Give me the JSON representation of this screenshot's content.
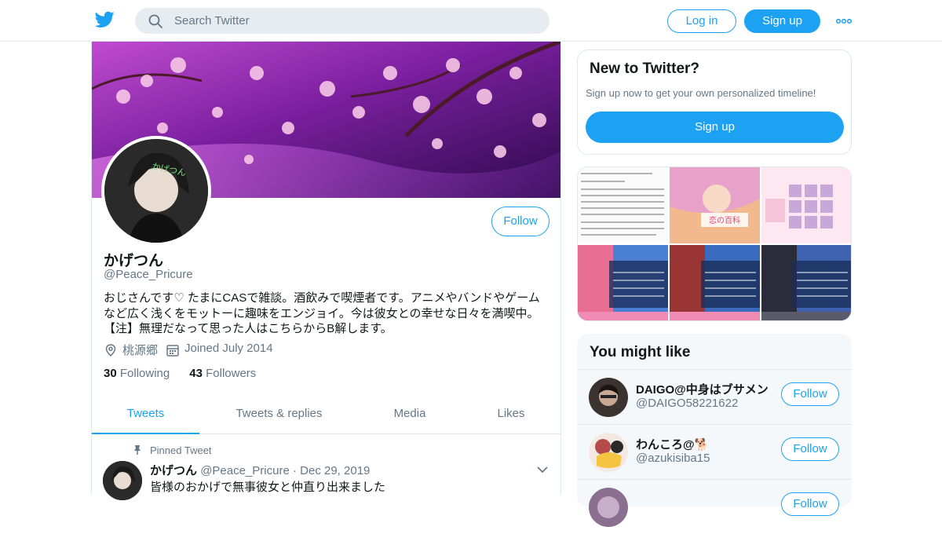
{
  "header": {
    "search_placeholder": "Search Twitter",
    "login_label": "Log in",
    "signup_label": "Sign up",
    "brand_color": "#1da1f2"
  },
  "profile": {
    "avatar_overlay": "かげつん",
    "name": "かげつん",
    "handle": "@Peace_Pricure",
    "follow_label": "Follow",
    "bio": "おじさんです♡ たまにCASで雑談。酒飲みで喫煙者です。アニメやバンドやゲームなど広く浅くをモットーに趣味をエンジョイ。今は彼女との幸せな日々を満喫中。【注】無理だなって思った人はこちらからB解します。",
    "location": "桃源郷",
    "joined": "Joined July 2014",
    "following_count": "30",
    "following_label": "Following",
    "followers_count": "43",
    "followers_label": "Followers"
  },
  "tabs": [
    {
      "label": "Tweets",
      "active": true
    },
    {
      "label": "Tweets & replies",
      "active": false
    },
    {
      "label": "Media",
      "active": false
    },
    {
      "label": "Likes",
      "active": false
    }
  ],
  "pinned_tweet": {
    "pinned_label": "Pinned Tweet",
    "name": "かげつん",
    "handle": "@Peace_Pricure",
    "date": "· Dec 29, 2019",
    "text": "皆様のおかげで無事彼女と仲直り出来ました"
  },
  "new_to_twitter": {
    "title": "New to Twitter?",
    "subtitle": "Sign up now to get your own personalized timeline!",
    "button_label": "Sign up"
  },
  "media_thumbs": {
    "banner_text": "恋の百科"
  },
  "you_might_like": {
    "title": "You might like",
    "users": [
      {
        "name": "DAIGO@中身はブサメン",
        "handle": "@DAIGO58221622",
        "follow_label": "Follow"
      },
      {
        "name": "わんころ@🐕",
        "handle": "@azukisiba15",
        "follow_label": "Follow"
      },
      {
        "name": "",
        "handle": "",
        "follow_label": "Follow"
      }
    ]
  }
}
